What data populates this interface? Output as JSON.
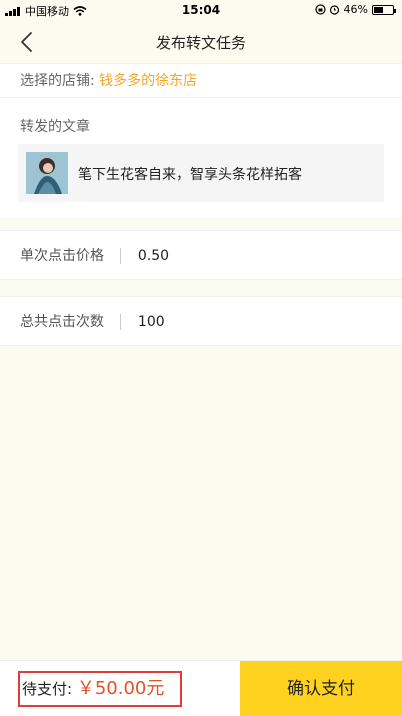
{
  "status_bar": {
    "carrier": "中国移动",
    "time": "15:04",
    "battery_percent": "46%",
    "battery_level": 0.46
  },
  "nav": {
    "title": "发布转文任务",
    "back_icon": "chevron-left-icon"
  },
  "shop": {
    "label": "选择的店铺:",
    "name": "钱多多的徐东店"
  },
  "article": {
    "section_title": "转发的文章",
    "title": "笔下生花客自来，智享头条花样拓客"
  },
  "fields": {
    "price_label": "单次点击价格",
    "price_value": "0.50",
    "count_label": "总共点击次数",
    "count_value": "100"
  },
  "footer": {
    "total_label": "待支付:",
    "total_amount": "￥50.00元",
    "confirm_label": "确认支付"
  },
  "colors": {
    "accent": "#ffd21f",
    "shop_name": "#f5a623",
    "amount": "#e0532b",
    "highlight_border": "#e03c3c"
  }
}
